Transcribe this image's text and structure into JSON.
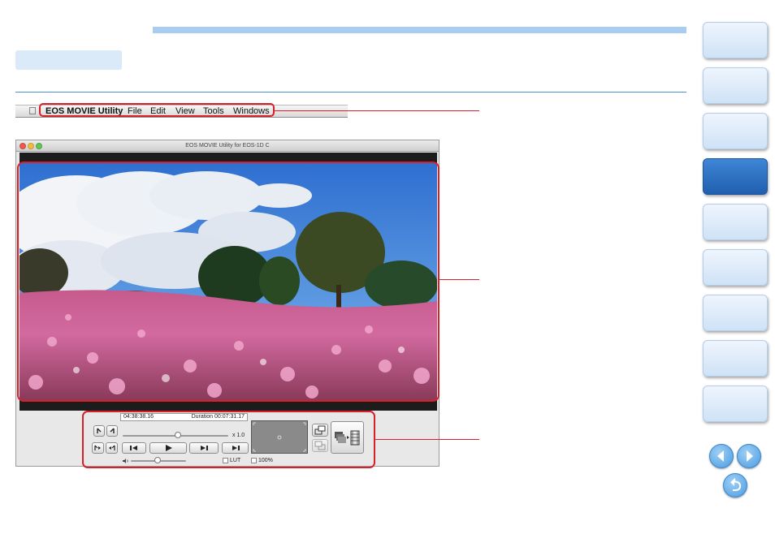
{
  "menubar": {
    "items": [
      "EOS MOVIE Utility",
      "File",
      "Edit",
      "View",
      "Tools",
      "Windows"
    ]
  },
  "window": {
    "title": "EOS MOVIE Utility for EOS-1D C"
  },
  "controls": {
    "timecode": "04:38:38.16",
    "duration": "Duration 00:07:31.17",
    "speed": "x 1.0",
    "lut_label": "LUT",
    "zoom_label": "100%"
  },
  "colors": {
    "highlight_red": "#d8202a",
    "accent_blue": "#1f5fae"
  },
  "icons": {
    "menubar": "apple-logo-icon",
    "nav": [
      "prev-page-icon",
      "next-page-icon",
      "return-icon"
    ]
  },
  "sidebar": {
    "tab_count": 9,
    "active_tab_index": 3
  }
}
